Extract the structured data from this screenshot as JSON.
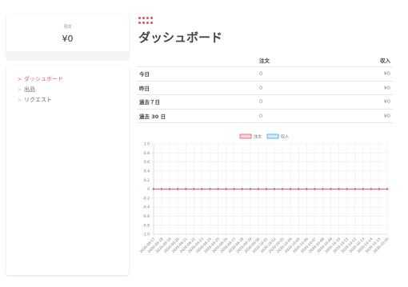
{
  "balance": {
    "label": "残高",
    "value": "¥0"
  },
  "nav": {
    "items": [
      {
        "label": "ダッシュボード",
        "active": true
      },
      {
        "label": "出品",
        "active": false
      },
      {
        "label": "リクエスト",
        "active": false
      }
    ]
  },
  "header": {
    "title": "ダッシュボード"
  },
  "stats": {
    "headers": {
      "label": "",
      "orders": "注文",
      "revenue": "収入"
    },
    "rows": [
      {
        "label": "今日",
        "orders": "0",
        "revenue": "¥0"
      },
      {
        "label": "昨日",
        "orders": "0",
        "revenue": "¥0"
      },
      {
        "label": "過去７日",
        "orders": "0",
        "revenue": "¥0"
      },
      {
        "label": "過去 30 日",
        "orders": "0",
        "revenue": "¥0"
      }
    ]
  },
  "colors": {
    "accent": "#e05a6d",
    "revenue": "#36a2eb"
  },
  "chart_data": {
    "type": "line",
    "legend_position": "top",
    "grid": true,
    "ylim": [
      -1.0,
      1.0
    ],
    "yticks": [
      "1.0",
      "0.8",
      "0.6",
      "0.4",
      "0.2",
      "0",
      "-0.2",
      "-0.4",
      "-0.6",
      "-0.8",
      "-1.0"
    ],
    "x": [
      "2020-09-17",
      "2020-09-18",
      "2020-09-19",
      "2020-09-20",
      "2020-09-21",
      "2020-09-22",
      "2020-09-23",
      "2020-09-24",
      "2020-09-25",
      "2020-09-26",
      "2020-09-27",
      "2020-09-28",
      "2020-09-29",
      "2020-09-30",
      "2020-10-01",
      "2020-10-02",
      "2020-10-03",
      "2020-10-04",
      "2020-10-05",
      "2020-10-06",
      "2020-10-07",
      "2020-10-08",
      "2020-10-09",
      "2020-10-10",
      "2020-10-11",
      "2020-10-12",
      "2020-10-13",
      "2020-10-14",
      "2020-10-15",
      "2020-10-16"
    ],
    "series": [
      {
        "name": "注文",
        "color": "#e05a6d",
        "values": [
          0,
          0,
          0,
          0,
          0,
          0,
          0,
          0,
          0,
          0,
          0,
          0,
          0,
          0,
          0,
          0,
          0,
          0,
          0,
          0,
          0,
          0,
          0,
          0,
          0,
          0,
          0,
          0,
          0,
          0
        ]
      },
      {
        "name": "収入",
        "color": "#36a2eb",
        "values": [
          0,
          0,
          0,
          0,
          0,
          0,
          0,
          0,
          0,
          0,
          0,
          0,
          0,
          0,
          0,
          0,
          0,
          0,
          0,
          0,
          0,
          0,
          0,
          0,
          0,
          0,
          0,
          0,
          0,
          0
        ]
      }
    ]
  }
}
